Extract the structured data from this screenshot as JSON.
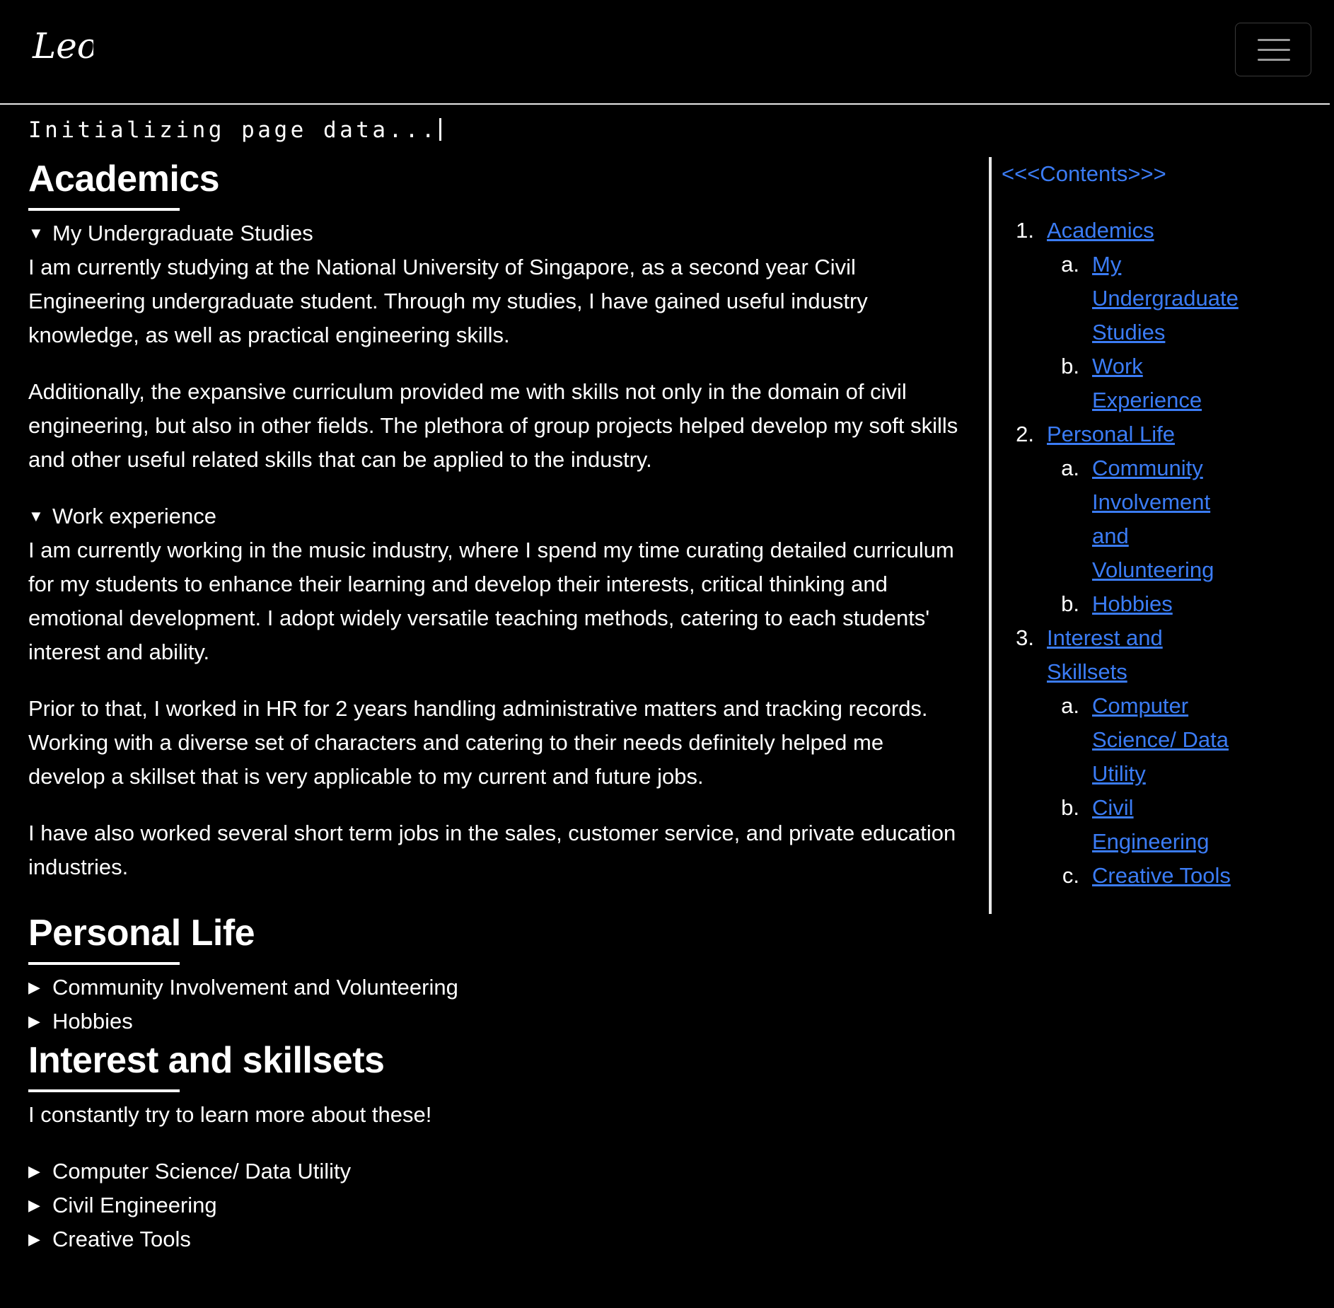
{
  "header": {
    "logo_text": "Leo",
    "menu_icon": "hamburger-menu-icon"
  },
  "status_text": "Initializing page data...",
  "sections": {
    "academics": {
      "title": "Academics",
      "undergrad": {
        "summary": "My Undergraduate Studies",
        "p1": "I am currently studying at the National University of Singapore, as a second year Civil Engineering undergraduate student. Through my studies, I have gained useful industry knowledge, as well as practical engineering skills.",
        "p2": "Additionally, the expansive curriculum provided me with skills not only in the domain of civil engineering, but also in other fields. The plethora of group projects helped develop my soft skills and other useful related skills that can be applied to the industry."
      },
      "work": {
        "summary": "Work experience",
        "p1": "I am currently working in the music industry, where I spend my time curating detailed curriculum for my students to enhance their learning and develop their interests, critical thinking and emotional development. I adopt widely versatile teaching methods, catering to each students' interest and ability.",
        "p2": "Prior to that, I worked in HR for 2 years handling administrative matters and tracking records. Working with a diverse set of characters and catering to their needs definitely helped me develop a skillset that is very applicable to my current and future jobs.",
        "p3": "I have also worked several short term jobs in the sales, customer service, and private education industries."
      }
    },
    "personal": {
      "title": "Personal Life",
      "items": [
        "Community Involvement and Volunteering",
        "Hobbies"
      ]
    },
    "interest": {
      "title": "Interest and skillsets",
      "intro": "I constantly try to learn more about these!",
      "items": [
        "Computer Science/ Data Utility",
        "Civil Engineering",
        "Creative Tools"
      ]
    }
  },
  "toc": {
    "title": "<<<Contents>>>",
    "items": [
      {
        "num": "1.",
        "label": "Academics",
        "children": [
          {
            "num": "a.",
            "label": "My Undergraduate Studies"
          },
          {
            "num": "b.",
            "label": "Work Experience"
          }
        ]
      },
      {
        "num": "2.",
        "label": "Personal Life",
        "children": [
          {
            "num": "a.",
            "label": "Community Involvement and Volunteering"
          },
          {
            "num": "b.",
            "label": "Hobbies"
          }
        ]
      },
      {
        "num": "3.",
        "label": "Interest and Skillsets",
        "children": [
          {
            "num": "a.",
            "label": "Computer Science/ Data Utility"
          },
          {
            "num": "b.",
            "label": "Civil Engineering"
          },
          {
            "num": "c.",
            "label": "Creative Tools"
          }
        ]
      }
    ]
  },
  "colors": {
    "background": "#000000",
    "text": "#ffffff",
    "link": "#3b7cf5"
  }
}
